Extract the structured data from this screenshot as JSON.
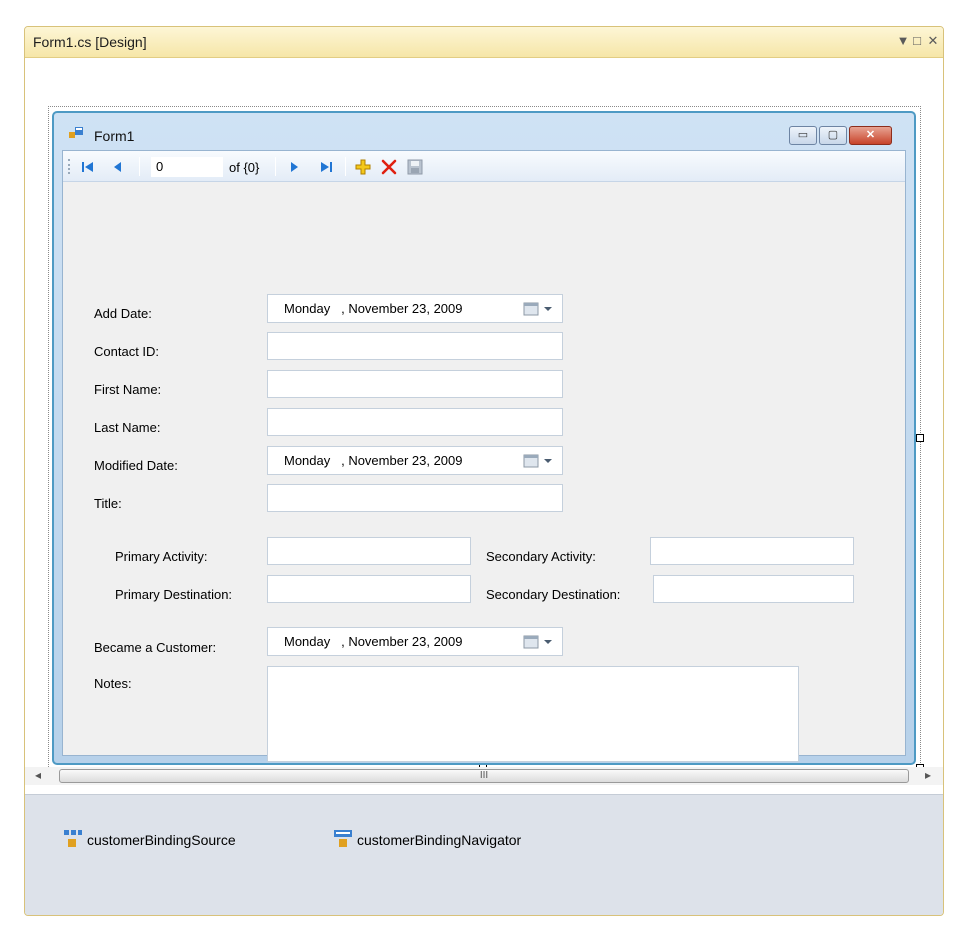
{
  "document": {
    "title": "Form1.cs [Design]",
    "controls": {
      "dropdown": "▼",
      "restore": "□",
      "close": "✕"
    }
  },
  "form": {
    "title": "Form1",
    "caption_buttons": {
      "minimize": "▭",
      "maximize": "▢",
      "close": "✕"
    }
  },
  "navigator": {
    "position_value": "0",
    "count_label": "of {0}",
    "icons": [
      "move-first-icon",
      "move-previous-icon",
      "move-next-icon",
      "move-last-icon",
      "add-new-icon",
      "delete-icon",
      "save-icon"
    ]
  },
  "fields": {
    "add_date": {
      "label": "Add Date:",
      "day": "Monday",
      "date": ", November 23, 2009"
    },
    "contact_id": {
      "label": "Contact ID:",
      "value": ""
    },
    "first_name": {
      "label": "First Name:",
      "value": ""
    },
    "last_name": {
      "label": "Last Name:",
      "value": ""
    },
    "modified_date": {
      "label": "Modified Date:",
      "day": "Monday",
      "date": ", November 23, 2009"
    },
    "title": {
      "label": "Title:",
      "value": ""
    },
    "primary_activity": {
      "label": "Primary Activity:",
      "value": ""
    },
    "secondary_activity": {
      "label": "Secondary Activity:",
      "value": ""
    },
    "primary_destination": {
      "label": "Primary Destination:",
      "value": ""
    },
    "secondary_destination": {
      "label": "Secondary Destination:",
      "value": ""
    },
    "became_customer": {
      "label": "Became a Customer:",
      "day": "Monday",
      "date": ", November 23, 2009"
    },
    "notes": {
      "label": "Notes:",
      "value": ""
    }
  },
  "scrollbar": {
    "left": "◂",
    "right": "▸",
    "thumb_grip": "III"
  },
  "tray": {
    "items": [
      {
        "label": "customerBindingSource",
        "icon": "binding-source-icon"
      },
      {
        "label": "customerBindingNavigator",
        "icon": "binding-navigator-icon"
      }
    ]
  },
  "colors": {
    "form_border": "#4e9ac4",
    "close_button": "#c7432a",
    "nav_arrow": "#2176d4",
    "add_icon": "#e8b400",
    "delete_icon": "#e02010"
  }
}
